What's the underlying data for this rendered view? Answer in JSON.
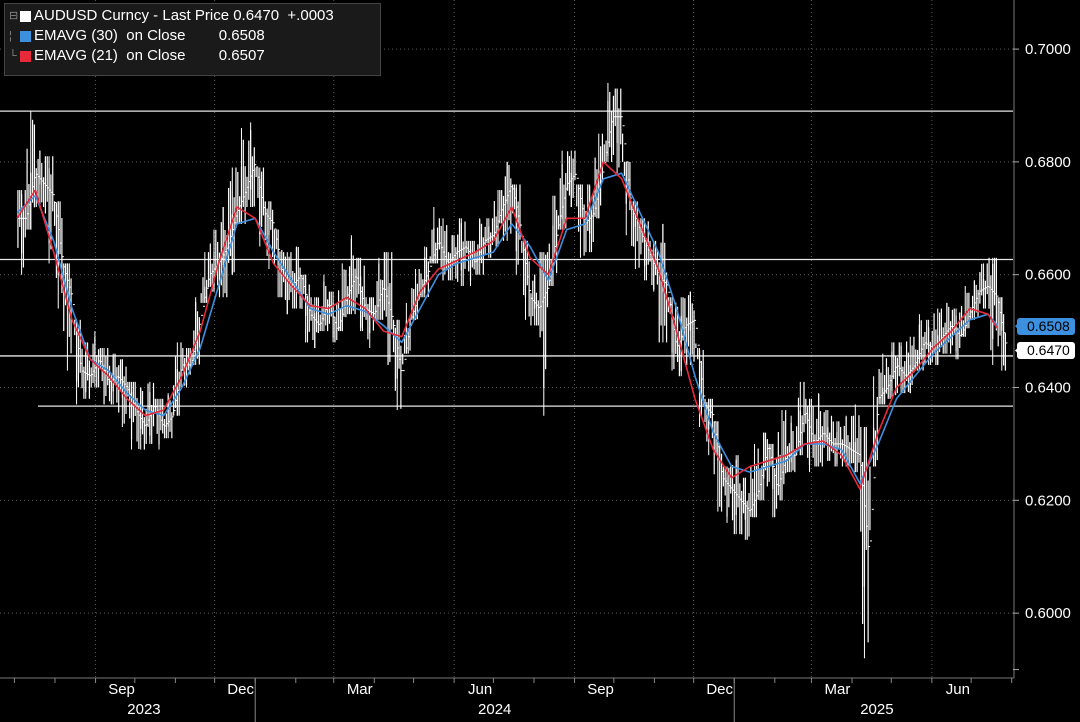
{
  "legend": {
    "toggle_glyph": "⊟",
    "rows": [
      {
        "color": "#ffffff",
        "text": "AUDUSD Curncy - Last Price 0.6470  +.0003"
      },
      {
        "color": "#3d8fe0",
        "text": "EMAVG (30)  on Close        0.6508"
      },
      {
        "color": "#e8293a",
        "text": "EMAVG (21)  on Close        0.6507"
      }
    ]
  },
  "badges": {
    "ema30": {
      "text": "0.6508",
      "color": "#3d8fe0"
    },
    "last": {
      "text": "0.6470",
      "color": "#ffffff"
    }
  },
  "chart_data": {
    "type": "line",
    "title": "AUDUSD Curncy - Last Price",
    "x_axis": {
      "months": [
        "Sep",
        "Dec",
        "Mar",
        "Jun",
        "Sep",
        "Dec",
        "Mar",
        "Jun"
      ],
      "years": [
        "2023",
        "2024",
        "2025"
      ]
    },
    "y_axis": {
      "ticks": [
        "0.7000",
        "0.6800",
        "0.6600",
        "0.6400",
        "0.6200",
        "0.6000"
      ],
      "ylim": [
        0.5885,
        0.7087
      ],
      "side": "right"
    },
    "horizontal_levels": [
      0.689,
      0.6627,
      0.6456,
      0.6367
    ],
    "series": [
      {
        "name": "AUDUSD Curncy - Last Price",
        "color": "#ffffff",
        "style": "high-low bars",
        "x": [
          "2023-07-03",
          "2023-07-10",
          "2023-07-17",
          "2023-07-24",
          "2023-07-31",
          "2023-08-07",
          "2023-08-14",
          "2023-08-21",
          "2023-08-28",
          "2023-09-04",
          "2023-09-11",
          "2023-09-18",
          "2023-09-25",
          "2023-10-02",
          "2023-10-09",
          "2023-10-16",
          "2023-10-23",
          "2023-10-30",
          "2023-11-06",
          "2023-11-13",
          "2023-11-20",
          "2023-11-27",
          "2023-12-04",
          "2023-12-11",
          "2023-12-18",
          "2023-12-25",
          "2024-01-01",
          "2024-01-08",
          "2024-01-15",
          "2024-01-22",
          "2024-01-29",
          "2024-02-05",
          "2024-02-12",
          "2024-02-19",
          "2024-02-26",
          "2024-03-04",
          "2024-03-11",
          "2024-03-18",
          "2024-03-25",
          "2024-04-01",
          "2024-04-08",
          "2024-04-15",
          "2024-04-22",
          "2024-04-29",
          "2024-05-06",
          "2024-05-13",
          "2024-05-20",
          "2024-05-27",
          "2024-06-03",
          "2024-06-10",
          "2024-06-17",
          "2024-06-24",
          "2024-07-01",
          "2024-07-08",
          "2024-07-15",
          "2024-07-22",
          "2024-07-29",
          "2024-08-05",
          "2024-08-12",
          "2024-08-19",
          "2024-08-26",
          "2024-09-02",
          "2024-09-09",
          "2024-09-16",
          "2024-09-23",
          "2024-09-30",
          "2024-10-07",
          "2024-10-14",
          "2024-10-21",
          "2024-10-28",
          "2024-11-04",
          "2024-11-11",
          "2024-11-18",
          "2024-11-25",
          "2024-12-02",
          "2024-12-09",
          "2024-12-16",
          "2024-12-23",
          "2024-12-30",
          "2025-01-06",
          "2025-01-13",
          "2025-01-20",
          "2025-01-27",
          "2025-02-03",
          "2025-02-10",
          "2025-02-17",
          "2025-02-24",
          "2025-03-03",
          "2025-03-10",
          "2025-03-17",
          "2025-03-24",
          "2025-03-31",
          "2025-04-07",
          "2025-04-14",
          "2025-04-21",
          "2025-04-28",
          "2025-05-05",
          "2025-05-12",
          "2025-05-19",
          "2025-05-26",
          "2025-06-02",
          "2025-06-09",
          "2025-06-16",
          "2025-06-23",
          "2025-06-30",
          "2025-07-07",
          "2025-07-14",
          "2025-07-21"
        ],
        "close": [
          0.67,
          0.678,
          0.676,
          0.674,
          0.662,
          0.656,
          0.643,
          0.642,
          0.645,
          0.641,
          0.642,
          0.64,
          0.636,
          0.633,
          0.637,
          0.633,
          0.635,
          0.644,
          0.644,
          0.652,
          0.66,
          0.662,
          0.665,
          0.671,
          0.675,
          0.68,
          0.671,
          0.669,
          0.66,
          0.658,
          0.66,
          0.653,
          0.651,
          0.655,
          0.65,
          0.656,
          0.66,
          0.654,
          0.653,
          0.658,
          0.652,
          0.642,
          0.652,
          0.657,
          0.661,
          0.666,
          0.662,
          0.664,
          0.665,
          0.662,
          0.666,
          0.667,
          0.672,
          0.676,
          0.668,
          0.656,
          0.654,
          0.658,
          0.668,
          0.676,
          0.678,
          0.669,
          0.671,
          0.679,
          0.688,
          0.688,
          0.672,
          0.668,
          0.664,
          0.66,
          0.658,
          0.647,
          0.651,
          0.652,
          0.637,
          0.635,
          0.624,
          0.622,
          0.62,
          0.618,
          0.622,
          0.63,
          0.622,
          0.628,
          0.628,
          0.636,
          0.63,
          0.632,
          0.63,
          0.63,
          0.629,
          0.628,
          0.61,
          0.638,
          0.64,
          0.644,
          0.642,
          0.644,
          0.648,
          0.647,
          0.649,
          0.651,
          0.649,
          0.653,
          0.657,
          0.658,
          0.656,
          0.647
        ],
        "high": [
          0.675,
          0.689,
          0.682,
          0.681,
          0.673,
          0.662,
          0.652,
          0.648,
          0.65,
          0.647,
          0.646,
          0.645,
          0.641,
          0.64,
          0.641,
          0.638,
          0.639,
          0.648,
          0.647,
          0.656,
          0.664,
          0.668,
          0.672,
          0.679,
          0.686,
          0.687,
          0.679,
          0.673,
          0.668,
          0.664,
          0.665,
          0.66,
          0.656,
          0.66,
          0.657,
          0.662,
          0.667,
          0.663,
          0.656,
          0.663,
          0.664,
          0.652,
          0.655,
          0.661,
          0.665,
          0.672,
          0.67,
          0.667,
          0.67,
          0.666,
          0.67,
          0.67,
          0.675,
          0.68,
          0.676,
          0.666,
          0.66,
          0.664,
          0.674,
          0.682,
          0.682,
          0.676,
          0.676,
          0.685,
          0.694,
          0.693,
          0.68,
          0.673,
          0.67,
          0.666,
          0.669,
          0.656,
          0.656,
          0.657,
          0.647,
          0.638,
          0.634,
          0.626,
          0.628,
          0.624,
          0.63,
          0.632,
          0.63,
          0.636,
          0.635,
          0.641,
          0.638,
          0.639,
          0.636,
          0.634,
          0.635,
          0.637,
          0.633,
          0.642,
          0.646,
          0.648,
          0.648,
          0.649,
          0.653,
          0.652,
          0.654,
          0.655,
          0.654,
          0.658,
          0.659,
          0.662,
          0.663,
          0.656
        ],
        "low": [
          0.66,
          0.668,
          0.672,
          0.662,
          0.654,
          0.643,
          0.637,
          0.638,
          0.64,
          0.637,
          0.637,
          0.633,
          0.629,
          0.629,
          0.63,
          0.629,
          0.631,
          0.635,
          0.64,
          0.644,
          0.655,
          0.657,
          0.656,
          0.66,
          0.669,
          0.672,
          0.665,
          0.661,
          0.656,
          0.653,
          0.654,
          0.648,
          0.647,
          0.65,
          0.648,
          0.65,
          0.653,
          0.65,
          0.647,
          0.652,
          0.644,
          0.636,
          0.646,
          0.652,
          0.656,
          0.662,
          0.659,
          0.659,
          0.658,
          0.658,
          0.66,
          0.663,
          0.665,
          0.666,
          0.66,
          0.652,
          0.651,
          0.635,
          0.658,
          0.668,
          0.672,
          0.663,
          0.664,
          0.67,
          0.68,
          0.678,
          0.667,
          0.661,
          0.659,
          0.657,
          0.648,
          0.643,
          0.642,
          0.644,
          0.633,
          0.628,
          0.618,
          0.616,
          0.614,
          0.613,
          0.617,
          0.62,
          0.617,
          0.62,
          0.625,
          0.628,
          0.625,
          0.626,
          0.627,
          0.626,
          0.626,
          0.625,
          0.592,
          0.626,
          0.637,
          0.638,
          0.639,
          0.639,
          0.643,
          0.644,
          0.644,
          0.646,
          0.645,
          0.649,
          0.652,
          0.654,
          0.644,
          0.643
        ]
      },
      {
        "name": "EMAVG (30) on Close",
        "color": "#3d8fe0",
        "x": [
          "2023-07-03",
          "2023-07-17",
          "2023-07-31",
          "2023-08-14",
          "2023-08-28",
          "2023-09-11",
          "2023-09-25",
          "2023-10-09",
          "2023-10-23",
          "2023-11-06",
          "2023-11-20",
          "2023-12-04",
          "2023-12-18",
          "2024-01-01",
          "2024-01-15",
          "2024-01-29",
          "2024-02-12",
          "2024-02-26",
          "2024-03-11",
          "2024-03-25",
          "2024-04-08",
          "2024-04-22",
          "2024-05-06",
          "2024-05-20",
          "2024-06-03",
          "2024-06-17",
          "2024-07-01",
          "2024-07-15",
          "2024-07-29",
          "2024-08-12",
          "2024-08-26",
          "2024-09-09",
          "2024-09-23",
          "2024-10-07",
          "2024-10-21",
          "2024-11-04",
          "2024-11-18",
          "2024-12-02",
          "2024-12-16",
          "2024-12-30",
          "2025-01-13",
          "2025-01-27",
          "2025-02-10",
          "2025-02-24",
          "2025-03-10",
          "2025-03-24",
          "2025-04-07",
          "2025-04-21",
          "2025-05-05",
          "2025-05-19",
          "2025-06-02",
          "2025-06-16",
          "2025-06-30",
          "2025-07-14",
          "2025-07-21"
        ],
        "values": [
          0.671,
          0.674,
          0.666,
          0.654,
          0.645,
          0.643,
          0.639,
          0.636,
          0.635,
          0.64,
          0.647,
          0.658,
          0.669,
          0.67,
          0.664,
          0.659,
          0.654,
          0.653,
          0.6545,
          0.6535,
          0.651,
          0.648,
          0.654,
          0.66,
          0.662,
          0.663,
          0.664,
          0.669,
          0.665,
          0.659,
          0.668,
          0.669,
          0.677,
          0.678,
          0.671,
          0.664,
          0.654,
          0.642,
          0.632,
          0.626,
          0.625,
          0.626,
          0.627,
          0.63,
          0.63,
          0.629,
          0.623,
          0.63,
          0.638,
          0.642,
          0.646,
          0.649,
          0.652,
          0.653,
          0.651
        ]
      },
      {
        "name": "EMAVG (21) on Close",
        "color": "#e8293a",
        "x": [
          "2023-07-03",
          "2023-07-17",
          "2023-07-31",
          "2023-08-14",
          "2023-08-28",
          "2023-09-11",
          "2023-09-25",
          "2023-10-09",
          "2023-10-23",
          "2023-11-06",
          "2023-11-20",
          "2023-12-04",
          "2023-12-18",
          "2024-01-01",
          "2024-01-15",
          "2024-01-29",
          "2024-02-12",
          "2024-02-26",
          "2024-03-11",
          "2024-03-25",
          "2024-04-08",
          "2024-04-22",
          "2024-05-06",
          "2024-05-20",
          "2024-06-03",
          "2024-06-17",
          "2024-07-01",
          "2024-07-15",
          "2024-07-29",
          "2024-08-12",
          "2024-08-26",
          "2024-09-09",
          "2024-09-23",
          "2024-10-07",
          "2024-10-21",
          "2024-11-04",
          "2024-11-18",
          "2024-12-02",
          "2024-12-16",
          "2024-12-30",
          "2025-01-13",
          "2025-01-27",
          "2025-02-10",
          "2025-02-24",
          "2025-03-10",
          "2025-03-24",
          "2025-04-07",
          "2025-04-21",
          "2025-05-05",
          "2025-05-19",
          "2025-06-02",
          "2025-06-16",
          "2025-06-30",
          "2025-07-14",
          "2025-07-21"
        ],
        "values": [
          0.67,
          0.675,
          0.664,
          0.652,
          0.645,
          0.642,
          0.638,
          0.635,
          0.636,
          0.642,
          0.65,
          0.662,
          0.672,
          0.67,
          0.662,
          0.658,
          0.6545,
          0.654,
          0.656,
          0.654,
          0.65,
          0.649,
          0.657,
          0.661,
          0.6625,
          0.664,
          0.666,
          0.672,
          0.663,
          0.66,
          0.67,
          0.67,
          0.68,
          0.677,
          0.669,
          0.661,
          0.65,
          0.638,
          0.629,
          0.624,
          0.626,
          0.627,
          0.628,
          0.63,
          0.6305,
          0.628,
          0.622,
          0.632,
          0.64,
          0.643,
          0.647,
          0.65,
          0.654,
          0.653,
          0.6505
        ]
      }
    ],
    "grid": true,
    "legend_position": "top-left"
  }
}
